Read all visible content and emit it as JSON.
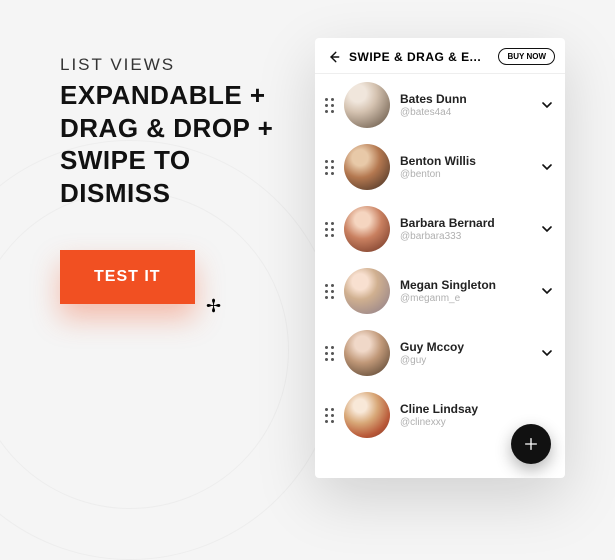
{
  "left": {
    "eyebrow": "LIST VIEWS",
    "headline_l1": "EXPANDABLE +",
    "headline_l2": "DRAG & DROP +",
    "headline_l3": "SWIPE TO",
    "headline_l4": "DISMISS",
    "cta": "TEST IT"
  },
  "phone": {
    "title": "SWIPE & DRAG & E...",
    "buy": "BUY NOW",
    "fab": "+",
    "rows": [
      {
        "name": "Bates Dunn",
        "handle": "@bates4a4"
      },
      {
        "name": "Benton Willis",
        "handle": "@benton"
      },
      {
        "name": "Barbara Bernard",
        "handle": "@barbara333"
      },
      {
        "name": "Megan Singleton",
        "handle": "@meganm_e"
      },
      {
        "name": "Guy Mccoy",
        "handle": "@guy"
      },
      {
        "name": "Cline Lindsay",
        "handle": "@clinexxy"
      }
    ]
  },
  "colors": {
    "accent": "#f15022"
  }
}
